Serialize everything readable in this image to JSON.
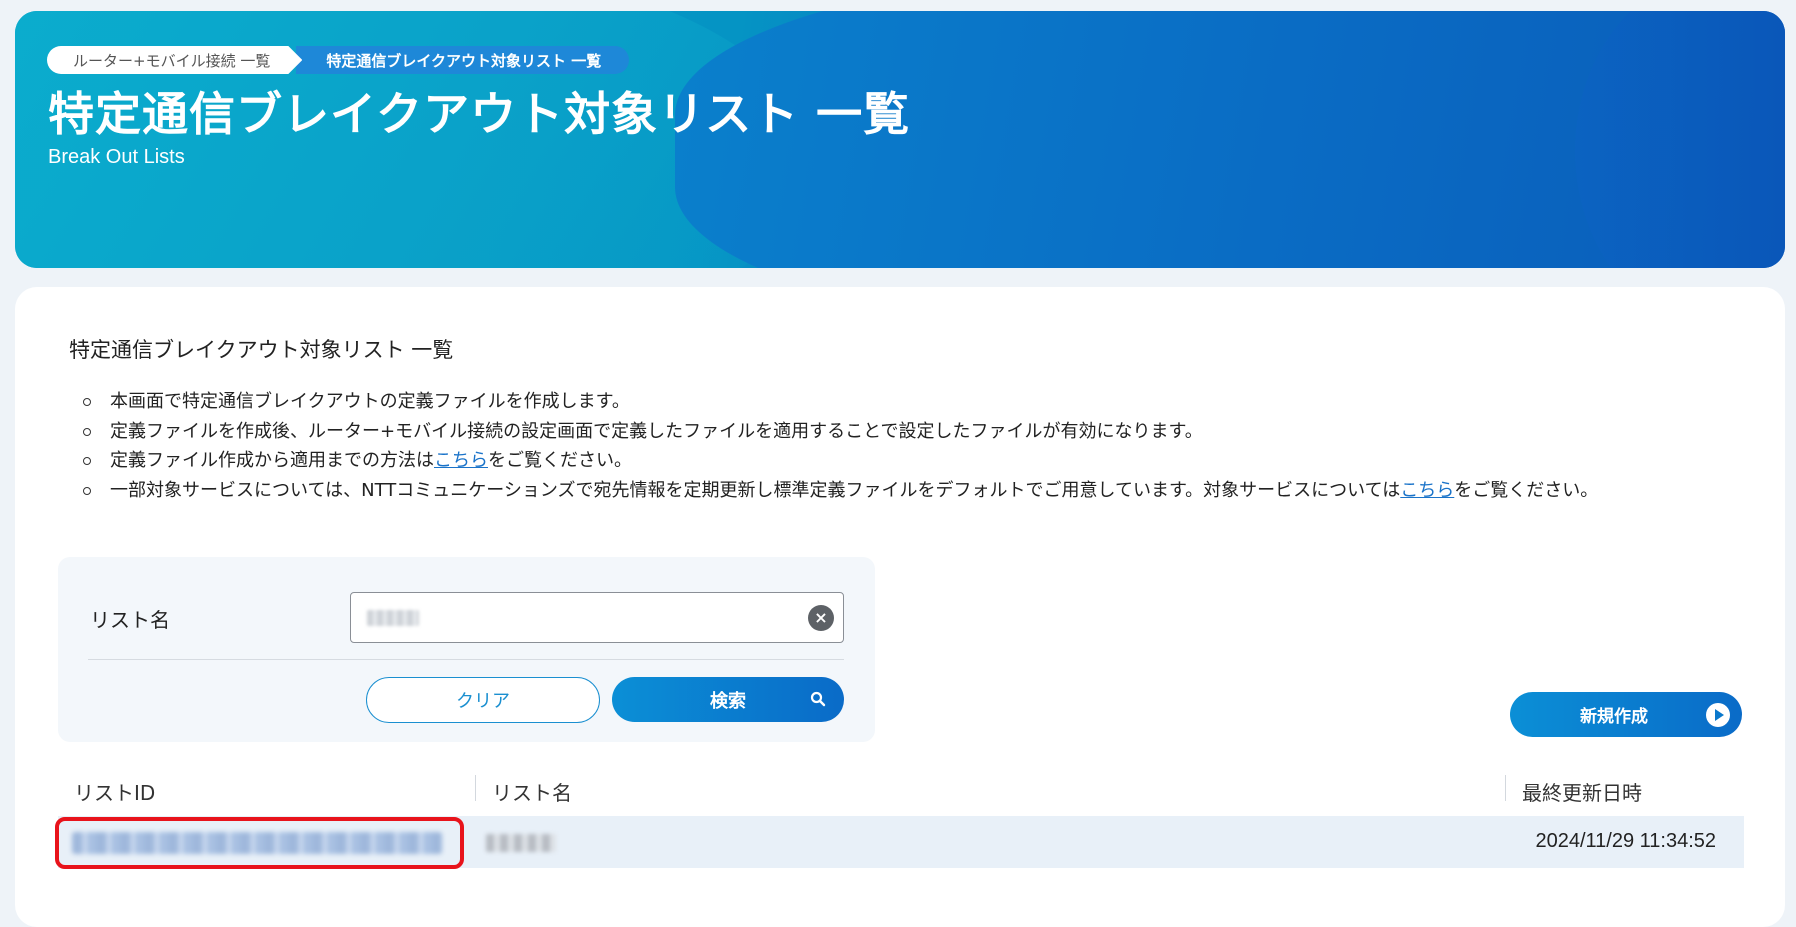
{
  "breadcrumb": {
    "items": [
      {
        "label": "ルーター+モバイル接続 一覧"
      },
      {
        "label": "特定通信ブレイクアウト対象リスト 一覧"
      }
    ]
  },
  "header": {
    "title": "特定通信ブレイクアウト対象リスト 一覧",
    "subtitle": "Break Out Lists"
  },
  "content": {
    "section_title": "特定通信ブレイクアウト対象リスト 一覧",
    "notes": [
      {
        "text": "本画面で特定通信ブレイクアウトの定義ファイルを作成します。"
      },
      {
        "text": "定義ファイルを作成後、ルーター+モバイル接続の設定画面で定義したファイルを適用することで設定したファイルが有効になります。"
      },
      {
        "before": "定義ファイル作成から適用までの方法は",
        "link": "こちら",
        "after": "をご覧ください。"
      },
      {
        "before": "一部対象サービスについては、NTTコミュニケーションズで宛先情報を定期更新し標準定義ファイルをデフォルトでご用意しています。対象サービスについては",
        "link": "こちら",
        "after": "をご覧ください。"
      }
    ]
  },
  "search": {
    "label": "リスト名",
    "value": "",
    "clear_label": "クリア",
    "search_label": "検索"
  },
  "actions": {
    "new_label": "新規作成"
  },
  "table": {
    "columns": [
      "リストID",
      "リスト名",
      "最終更新日時"
    ],
    "rows": [
      {
        "updated": "2024/11/29 11:34:52"
      }
    ]
  },
  "colors": {
    "accent": "#0a78cc",
    "highlight": "#e8131b",
    "link": "#1a73c9"
  }
}
